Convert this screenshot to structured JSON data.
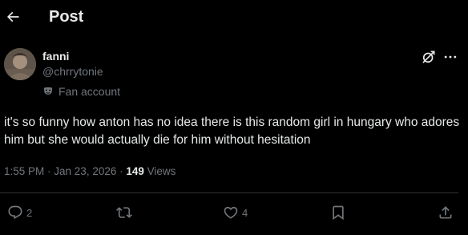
{
  "header": {
    "title": "Post",
    "back_icon": "arrow-left-icon"
  },
  "author": {
    "display_name": "fanni",
    "handle": "@chrrytonie",
    "badge_label": "Fan account",
    "badge_icon": "theater-masks-icon"
  },
  "post_actions": {
    "grok_icon": "grok-icon",
    "more_icon": "more-horizontal-icon"
  },
  "tweet": {
    "text": "it's so funny how anton has no idea there is this random girl in hungary who adores him but she would actually die for him without hesitation"
  },
  "meta": {
    "time": "1:55 PM",
    "separator": " · ",
    "date": "Jan 23, 2026",
    "views_count": "149",
    "views_label": " Views"
  },
  "actions": {
    "reply_count": "2",
    "repost_count": "",
    "like_count": "4"
  },
  "colors": {
    "background": "#000000",
    "text_primary": "#e7e9ea",
    "text_secondary": "#71767b",
    "divider": "#2f3336"
  }
}
